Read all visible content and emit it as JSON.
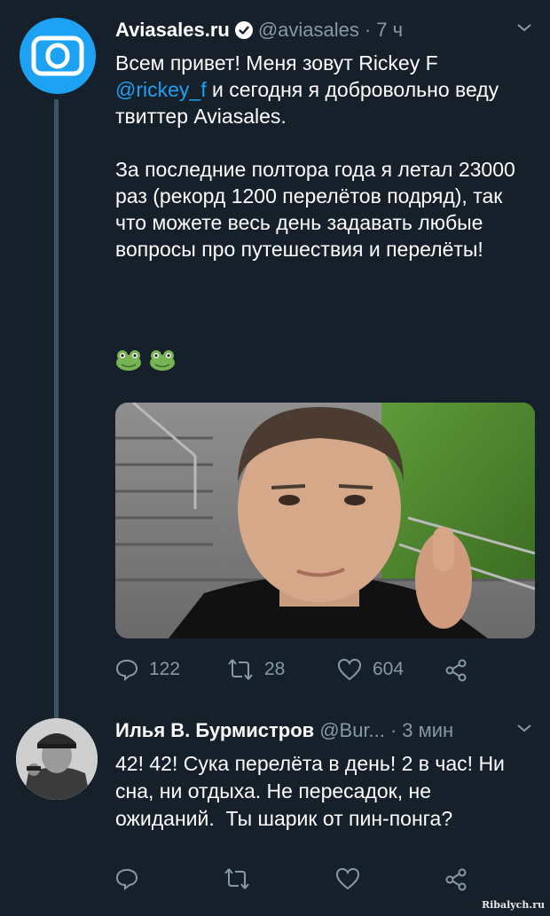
{
  "tweet": {
    "author_name": "Aviasales.ru",
    "handle": "@aviasales",
    "separator": "·",
    "time": "7 ч",
    "text_part1": "Всем привет! Меня зовут Rickey F ",
    "mention": "@rickey_f",
    "text_part2": " и сегодня я добровольно веду твиттер Aviasales.\n\nЗа последние полтора года я летал 23000 раз (рекорд 1200 перелётов подряд), так что можете весь день задавать любые вопросы про путешествия и перелёты!",
    "emoji": [
      "frog-emoji",
      "frog-emoji"
    ],
    "replies": "122",
    "retweets": "28",
    "likes": "604"
  },
  "reply": {
    "author_name": "Илья В. Бурмистров",
    "handle": "@Bur...",
    "separator": "·",
    "time": "3 мин",
    "text": "42! 42! Сука перелёта в день! 2 в час! Ни сна, ни отдыха. Не пересадок, не ожиданий.  Ты шарик от пин-понга?"
  },
  "watermark": "Ribalych.ru",
  "colors": {
    "background": "#15202b",
    "accent": "#1da1f2",
    "muted": "#8899a6"
  }
}
